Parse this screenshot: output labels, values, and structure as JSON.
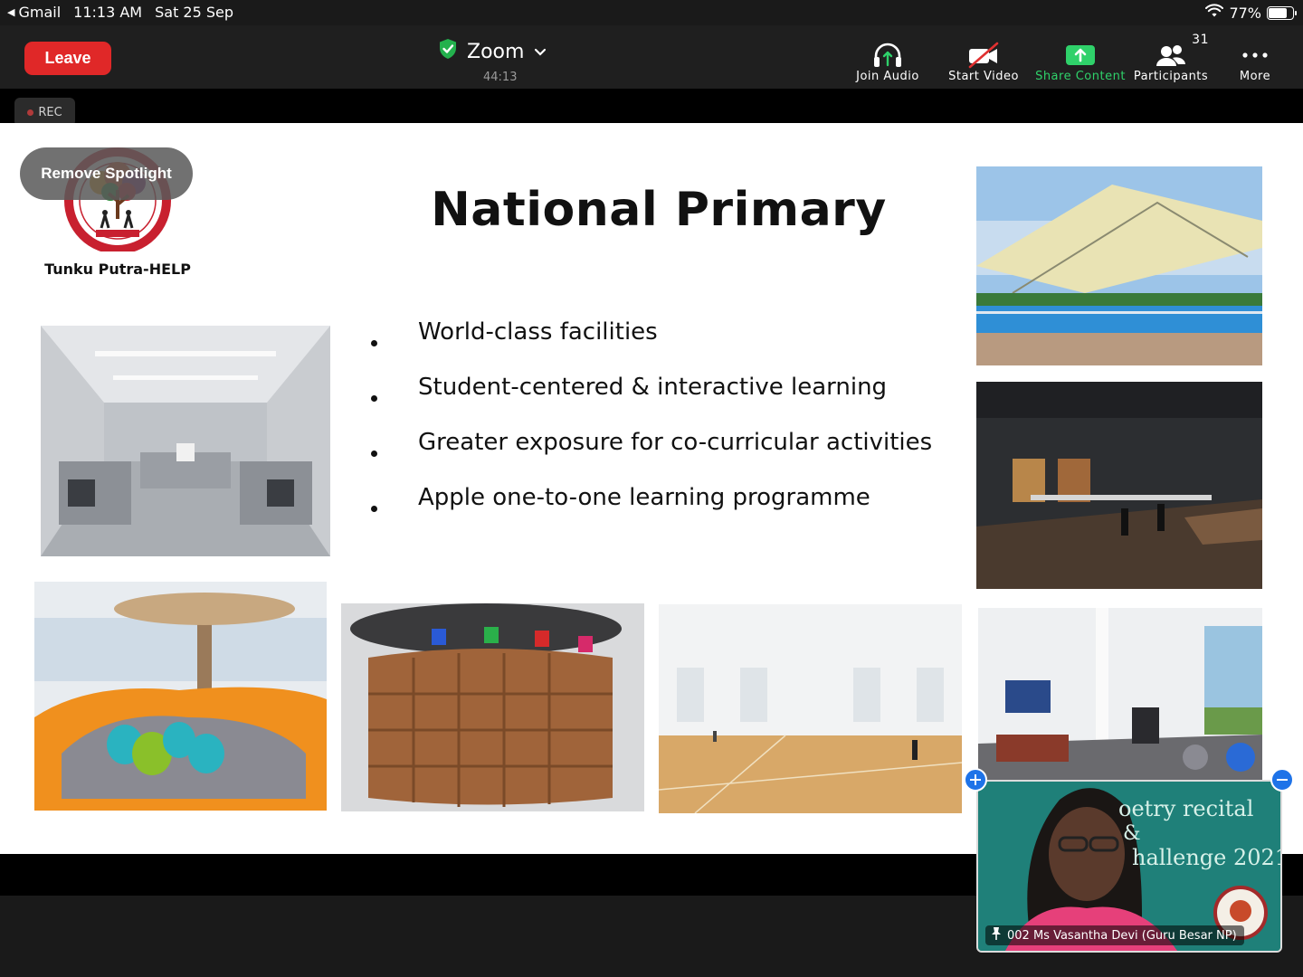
{
  "status_bar": {
    "back_app": "Gmail",
    "time": "11:13 AM",
    "date": "Sat 25 Sep",
    "battery": "77%",
    "battery_level": 0.77
  },
  "toolbar": {
    "leave_label": "Leave",
    "meeting_title": "Zoom",
    "timer": "44:13",
    "tools": [
      {
        "label": "Join Audio",
        "icon": "headphones-icon"
      },
      {
        "label": "Start Video",
        "icon": "video-off-icon"
      },
      {
        "label": "Share Content",
        "icon": "share-screen-icon"
      },
      {
        "label": "Participants",
        "icon": "participants-icon"
      },
      {
        "label": "More",
        "icon": "more-dots-icon"
      }
    ],
    "participants_count": "31",
    "accent_green": "#2fd16a",
    "leave_red": "#e02828"
  },
  "recording": {
    "label": "REC"
  },
  "spotlight": {
    "remove_label": "Remove Spotlight"
  },
  "slide": {
    "title": "National Primary",
    "school_name": "Tunku Putra-HELP",
    "bullets": [
      "World-class facilities",
      "Student-centered & interactive learning",
      "Greater exposure for co-curricular activities",
      "Apple one-to-one learning programme"
    ],
    "photos": [
      "kitchen-lab-photo",
      "swimming-pool-photo",
      "auditorium-photo",
      "reading-lounge-photo",
      "library-shelves-photo",
      "sports-hall-photo",
      "gym-photo"
    ]
  },
  "video_tile": {
    "participant": "002 Ms Vasantha Devi (Guru Besar NP)",
    "background_text_line1": "oetry recital",
    "background_text_line2": "&",
    "background_text_line3": "hallenge 2021"
  }
}
